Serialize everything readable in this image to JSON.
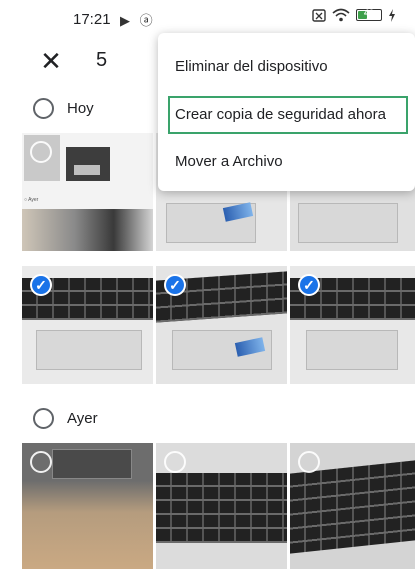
{
  "status_bar": {
    "time": "17:21",
    "left_icons": "▶ ⓐ",
    "right_icons": [
      "sim-icon",
      "wifi-icon",
      "battery-icon",
      "charging-icon"
    ],
    "battery_level": "40",
    "battery_fraction": 0.4
  },
  "top_bar": {
    "close_glyph": "✕",
    "selection_count": "5"
  },
  "menu": {
    "items": [
      {
        "label": "Eliminar del dispositivo"
      },
      {
        "label": "Crear copia de seguridad ahora"
      },
      {
        "label": "Mover a Archivo"
      }
    ]
  },
  "sections": [
    {
      "label": "Hoy"
    },
    {
      "label": "Ayer"
    }
  ],
  "photos_today_row1": [
    {
      "selected": false,
      "checkbox": "empty"
    },
    {
      "selected": false
    },
    {
      "selected": false
    }
  ],
  "photos_today_row2": [
    {
      "selected": true,
      "check_glyph": "✓"
    },
    {
      "selected": true,
      "check_glyph": "✓"
    },
    {
      "selected": true,
      "check_glyph": "✓"
    }
  ],
  "photos_yesterday": [
    {
      "selected": false
    },
    {
      "selected": false
    },
    {
      "selected": false
    }
  ],
  "colors": {
    "accent": "#1a73e8",
    "focus_border": "#3aa36b",
    "text": "#202124"
  }
}
